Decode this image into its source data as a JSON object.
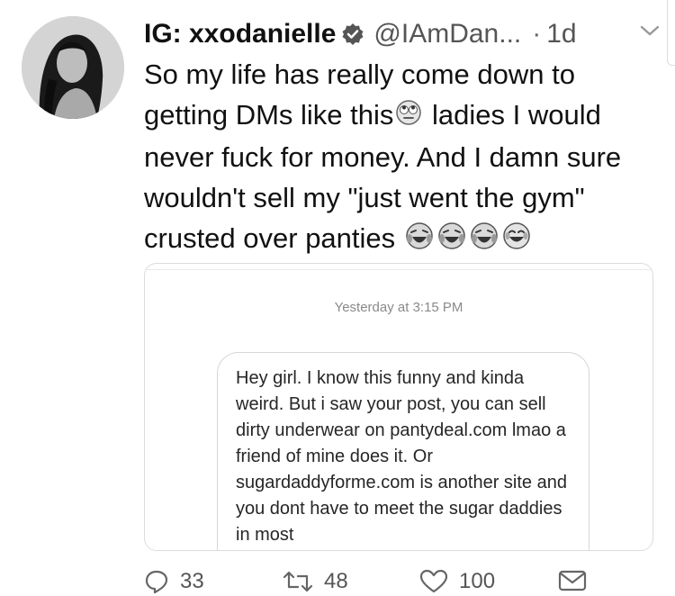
{
  "tweet": {
    "display_name": "IG: xxodanielle",
    "handle": "@IAmDan...",
    "time": "1d",
    "text_part1": "So my life has really come down to getting DMs like this",
    "text_part2": " ladies I would never fuck for money. And I damn sure wouldn't sell my \"just went the gym\" crusted over panties ",
    "icons": [
      "rolling-eyes-emoji",
      "crying-laughing-emoji"
    ]
  },
  "embedded_dm": {
    "timestamp": "Yesterday at 3:15 PM",
    "message": "Hey girl. I know this funny and kinda weird. But i saw your post, you can sell dirty underwear on pantydeal.com lmao a friend of mine does it. Or sugardaddyforme.com is another site and you dont have to meet the sugar daddies in most"
  },
  "actions": {
    "reply_count": "33",
    "retweet_count": "48",
    "like_count": "100"
  }
}
